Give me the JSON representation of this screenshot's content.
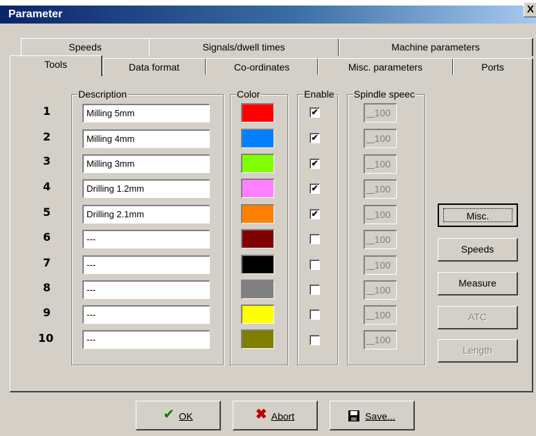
{
  "window": {
    "title": "Parameter",
    "close_label": "X"
  },
  "tabs_back": [
    "Speeds",
    "Signals/dwell times",
    "Machine parameters"
  ],
  "tabs_front": [
    "Tools",
    "Data format",
    "Co-ordinates",
    "Misc. parameters",
    "Ports"
  ],
  "groups": {
    "description": "Description",
    "color": "Color",
    "enable": "Enable",
    "spindle": "Spindle speec"
  },
  "tools": [
    {
      "num": "1",
      "desc": "Milling 5mm",
      "color": "#ff0000",
      "enabled": true,
      "speed": "100"
    },
    {
      "num": "2",
      "desc": "Milling 4mm",
      "color": "#0080ff",
      "enabled": true,
      "speed": "100"
    },
    {
      "num": "3",
      "desc": "Milling 3mm",
      "color": "#80ff00",
      "enabled": true,
      "speed": "100"
    },
    {
      "num": "4",
      "desc": "Drilling 1.2mm",
      "color": "#ff80ff",
      "enabled": true,
      "speed": "100"
    },
    {
      "num": "5",
      "desc": "Drilling 2.1mm",
      "color": "#ff8000",
      "enabled": true,
      "speed": "100"
    },
    {
      "num": "6",
      "desc": "---",
      "color": "#800000",
      "enabled": false,
      "speed": "100"
    },
    {
      "num": "7",
      "desc": "---",
      "color": "#000000",
      "enabled": false,
      "speed": "100"
    },
    {
      "num": "8",
      "desc": "---",
      "color": "#808080",
      "enabled": false,
      "speed": "100"
    },
    {
      "num": "9",
      "desc": "---",
      "color": "#ffff00",
      "enabled": false,
      "speed": "100"
    },
    {
      "num": "10",
      "desc": "---",
      "color": "#808000",
      "enabled": false,
      "speed": "100"
    }
  ],
  "side_buttons": {
    "misc": "Misc.",
    "speeds": "Speeds",
    "measure": "Measure",
    "atc": "ATC",
    "length": "Length"
  },
  "bottom_buttons": {
    "ok": "OK",
    "abort": "Abort",
    "save": "Save..."
  },
  "icons": {
    "ok": "check-icon",
    "abort": "x-icon",
    "save": "floppy-disk-icon"
  },
  "colors": {
    "title_gradient_start": "#0a246a",
    "face": "#d4d0c8",
    "ok_check": "#008000",
    "abort_x": "#c00000"
  }
}
